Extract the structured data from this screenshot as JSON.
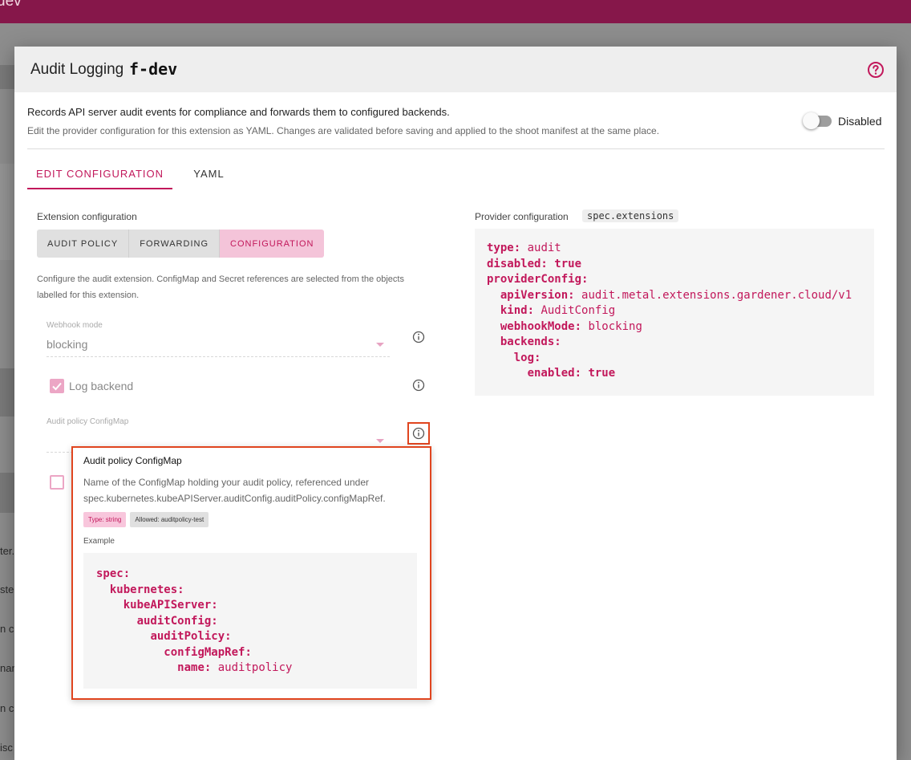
{
  "app": {
    "topbar_text": "dev"
  },
  "background": {
    "fragments": [
      "ter.",
      "ste",
      "n c",
      "nan",
      "n co",
      "isc"
    ]
  },
  "dialog": {
    "title": "Audit Logging",
    "name": "f-dev",
    "description": "Records API server audit events for compliance and forwards them to configured backends.",
    "subdescription": "Edit the provider configuration for this extension as YAML. Changes are validated before saving and applied to the shoot manifest at the same place.",
    "toggle": {
      "label": "Disabled",
      "state": "off"
    },
    "tabs": [
      {
        "label": "EDIT CONFIGURATION",
        "active": true
      },
      {
        "label": "YAML",
        "active": false
      }
    ]
  },
  "extension": {
    "label": "Extension configuration",
    "sections": [
      {
        "label": "AUDIT POLICY",
        "active": false
      },
      {
        "label": "FORWARDING",
        "active": false
      },
      {
        "label": "CONFIGURATION",
        "active": true
      }
    ],
    "help_text": "Configure the audit extension. ConfigMap and Secret references are selected from the objects labelled for this extension.",
    "webhook_mode": {
      "label": "Webhook mode",
      "value": "blocking"
    },
    "log_backend": {
      "label": "Log backend",
      "checked": true
    },
    "audit_policy": {
      "label": "Audit policy ConfigMap",
      "value": ""
    },
    "next_checkbox": {
      "checked": false
    }
  },
  "provider": {
    "label": "Provider configuration",
    "tag": "spec.extensions",
    "yaml": [
      {
        "indent": 0,
        "key": "type:",
        "value": "audit",
        "bold_value": false
      },
      {
        "indent": 0,
        "key": "disabled:",
        "value": "true",
        "bold_value": true
      },
      {
        "indent": 0,
        "key": "providerConfig:",
        "value": "",
        "bold_value": false
      },
      {
        "indent": 1,
        "key": "apiVersion:",
        "value": "audit.metal.extensions.gardener.cloud/v1",
        "bold_value": false
      },
      {
        "indent": 1,
        "key": "kind:",
        "value": "AuditConfig",
        "bold_value": false
      },
      {
        "indent": 1,
        "key": "webhookMode:",
        "value": "blocking",
        "bold_value": false
      },
      {
        "indent": 1,
        "key": "backends:",
        "value": "",
        "bold_value": false
      },
      {
        "indent": 2,
        "key": "log:",
        "value": "",
        "bold_value": false
      },
      {
        "indent": 3,
        "key": "enabled:",
        "value": "true",
        "bold_value": true
      }
    ]
  },
  "tooltip": {
    "title": "Audit policy ConfigMap",
    "description": "Name of the ConfigMap holding your audit policy, referenced under spec.kubernetes.kubeAPIServer.auditConfig.auditPolicy.configMapRef.",
    "badge_type": "Type: string",
    "badge_allowed": "Allowed: auditpolicy-test",
    "example_label": "Example",
    "example_yaml": [
      {
        "indent": 0,
        "key": "spec:",
        "value": ""
      },
      {
        "indent": 1,
        "key": "kubernetes:",
        "value": ""
      },
      {
        "indent": 2,
        "key": "kubeAPIServer:",
        "value": ""
      },
      {
        "indent": 3,
        "key": "auditConfig:",
        "value": ""
      },
      {
        "indent": 4,
        "key": "auditPolicy:",
        "value": ""
      },
      {
        "indent": 5,
        "key": "configMapRef:",
        "value": ""
      },
      {
        "indent": 6,
        "key": "name:",
        "value": "auditpolicy"
      }
    ]
  },
  "colors": {
    "accent": "#c2185b",
    "topbar": "#86174a",
    "highlight": "#e0451f"
  },
  "icons": [
    "help-circle-icon",
    "info-icon",
    "chevron-down-icon",
    "check-icon"
  ]
}
